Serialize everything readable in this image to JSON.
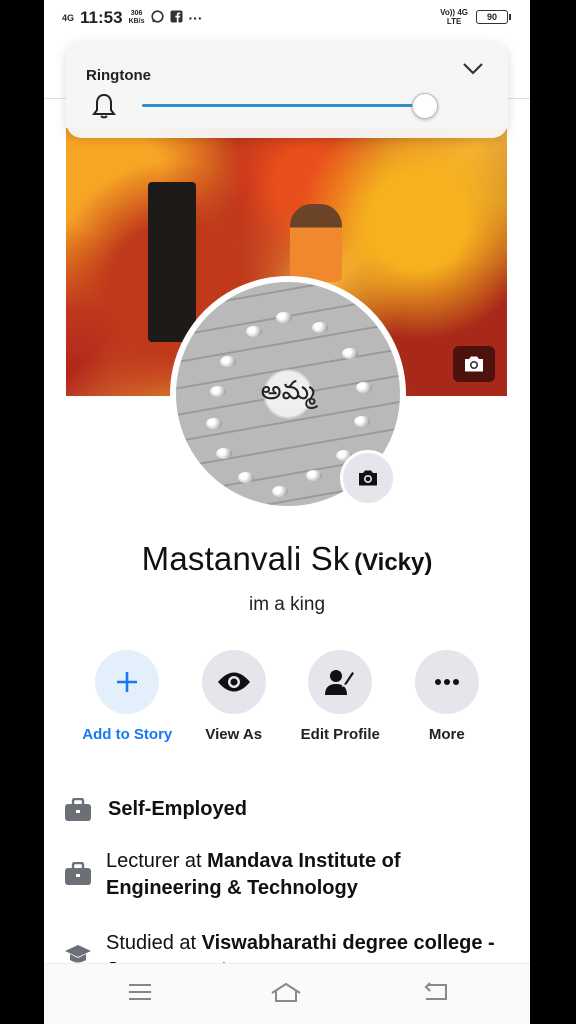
{
  "status_bar": {
    "network": "4G",
    "time": "11:53",
    "speed_value": "306",
    "speed_unit": "KB/s",
    "notification_icons": [
      "whatsapp-icon",
      "facebook-icon"
    ],
    "overflow": "···",
    "volte_top": "Vo)) 4G",
    "volte_bottom": "LTE",
    "battery": "90"
  },
  "ringtone_panel": {
    "label": "Ringtone",
    "volume_level": 0.95
  },
  "cover_photo": {
    "avatar_text": "అమ్మ"
  },
  "profile": {
    "name": "Mastanvali Sk",
    "nickname": "(Vicky)",
    "bio": "im a king"
  },
  "actions": [
    {
      "label": "Add to Story",
      "icon": "plus-icon"
    },
    {
      "label": "View As",
      "icon": "eye-icon"
    },
    {
      "label": "Edit Profile",
      "icon": "edit-profile-icon"
    },
    {
      "label": "More",
      "icon": "more-icon"
    }
  ],
  "details": {
    "work1": "Self-Employed",
    "work2_prefix": "Lecturer at ",
    "work2_place": "Mandava Institute of Engineering & Technology",
    "edu_prefix": "Studied at ",
    "edu_place": "Viswabharathi degree college - Jaggayyapet"
  },
  "colors": {
    "accent": "#1877f2",
    "slider": "#2f8fd0",
    "circle_bg": "#e4e6eb"
  }
}
